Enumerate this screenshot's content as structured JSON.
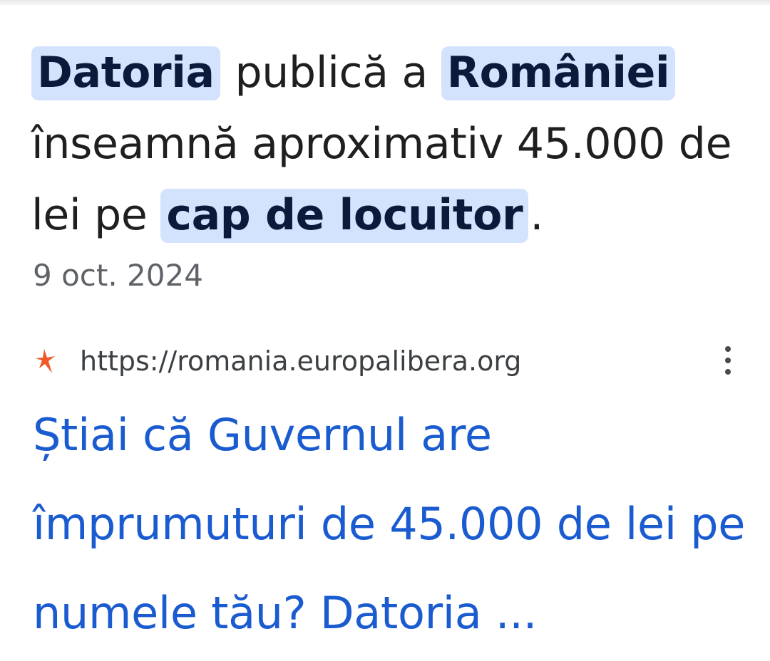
{
  "snippet": {
    "part1_hl": "Datoria",
    "part2": " publică a ",
    "part3_hl": "României",
    "part4": " înseamnă aproximativ 45.000 de lei pe ",
    "part5_hl": "cap de locuitor",
    "part6": "."
  },
  "date": "9 oct. 2024",
  "source": {
    "url": "https://romania.europalibera.org",
    "favicon": "rfe-rl-logo-icon",
    "menu_icon": "more-vert-icon"
  },
  "result": {
    "title": "Știai că Guvernul are împrumuturi de 45.000 de lei pe numele tău? Datoria ..."
  },
  "colors": {
    "highlight_bg": "#d3e3fd",
    "link": "#1a5bd0",
    "text": "#1f1f1f",
    "muted": "#5f6368",
    "favicon": "#ef5a28"
  }
}
